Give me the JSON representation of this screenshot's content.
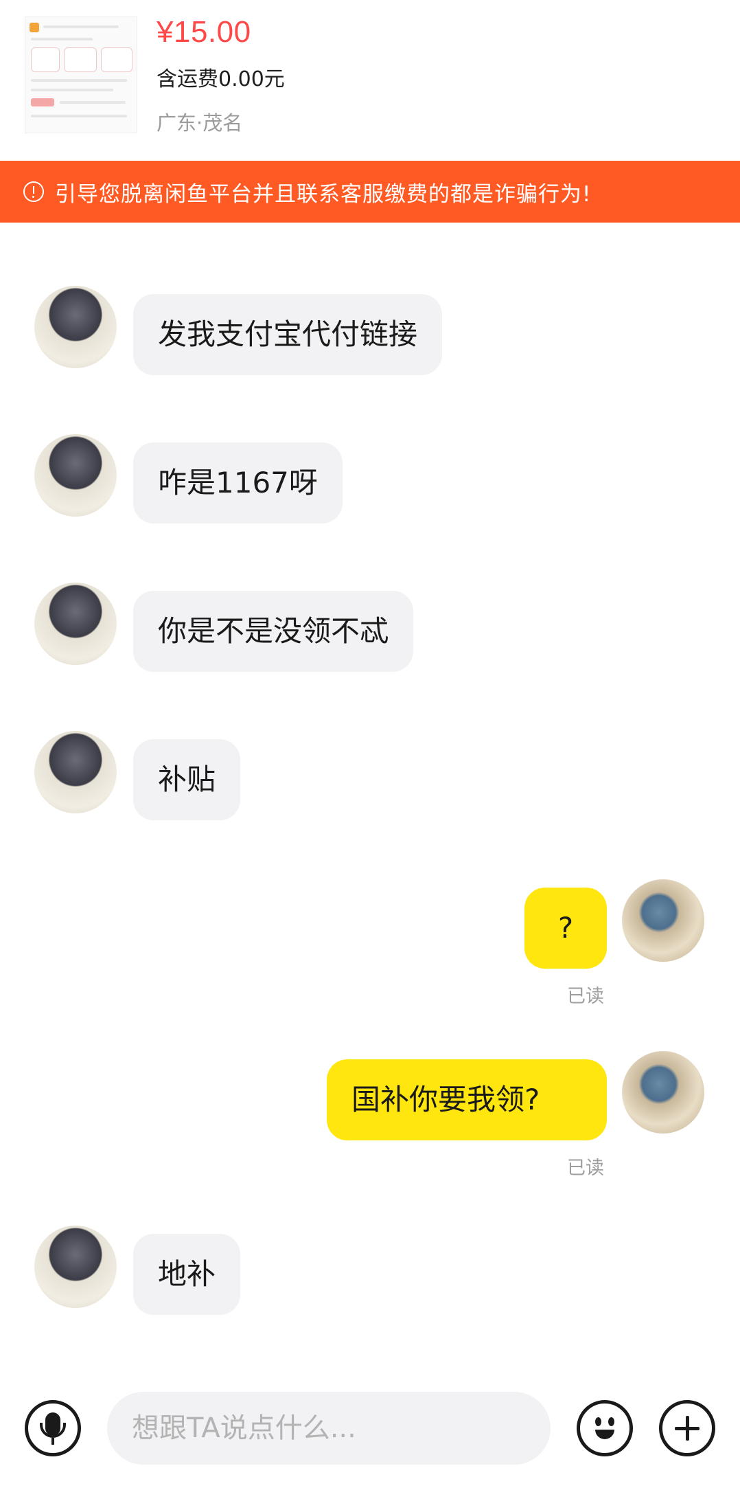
{
  "product": {
    "price": "¥15.00",
    "shipping": "含运费0.00元",
    "location": "广东·茂名"
  },
  "warning": {
    "text": "引导您脱离闲鱼平台并且联系客服缴费的都是诈骗行为!"
  },
  "messages": [
    {
      "sender": "other",
      "text": "发我支付宝代付链接"
    },
    {
      "sender": "other",
      "text": "咋是1167呀"
    },
    {
      "sender": "other",
      "text": "你是不是没领不忒"
    },
    {
      "sender": "other",
      "text": "补贴"
    },
    {
      "sender": "self",
      "text": "?",
      "status": "已读"
    },
    {
      "sender": "self",
      "text": "国补你要我领?",
      "status": "已读"
    },
    {
      "sender": "other",
      "text": "地补"
    }
  ],
  "input": {
    "placeholder": "想跟TA说点什么..."
  },
  "colors": {
    "price": "#ff4949",
    "warning_bg": "#ff5a24",
    "self_bubble": "#ffe60f",
    "other_bubble": "#f2f2f4"
  },
  "icons": [
    "warning-icon",
    "microphone-icon",
    "emoji-icon",
    "plus-icon"
  ]
}
